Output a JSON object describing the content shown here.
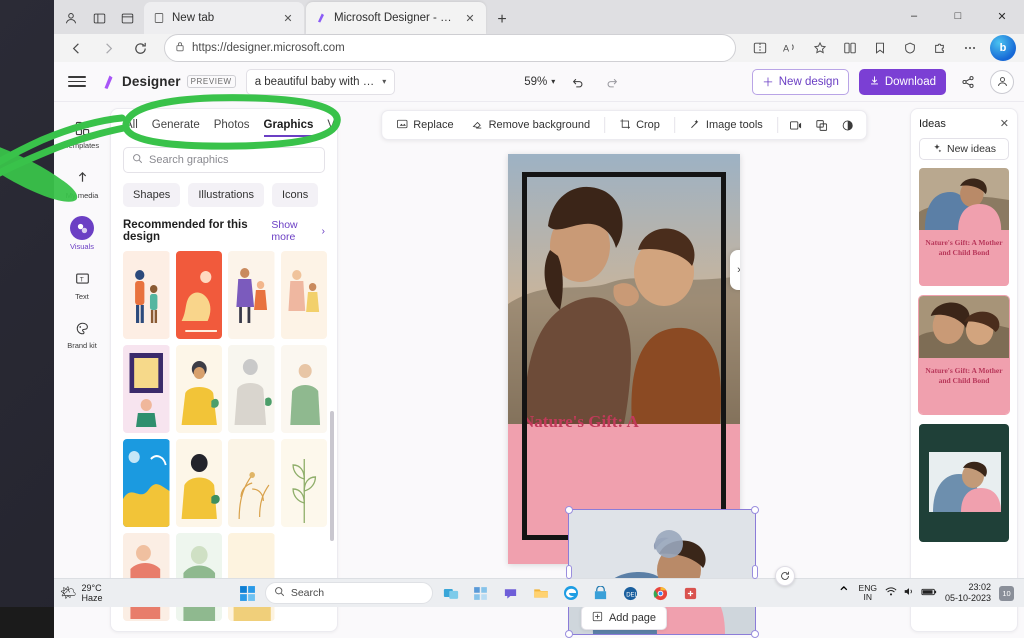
{
  "browser": {
    "tabs": [
      {
        "label": "New tab",
        "favicon": "page-icon",
        "active": false
      },
      {
        "label": "Microsoft Designer - Stunning d…",
        "favicon": "designer-icon",
        "active": true
      }
    ],
    "new_tab_label": "+",
    "url": "https://designer.microsoft.com",
    "url_lock_icon": "lock-icon",
    "window_controls": {
      "minimize": "–",
      "maximize": "□",
      "close": "✕"
    },
    "nav": {
      "back": "back-icon",
      "forward": "forward-icon",
      "refresh": "refresh-icon",
      "split_screen": "split-screen-icon",
      "read_aloud": "read-aloud-icon",
      "favorite": "star-icon",
      "collections": "collections-icon",
      "favorites_bar": "favorites-icon",
      "browser_essentials": "essentials-icon",
      "extensions": "puzzle-icon",
      "settings": "more-icon",
      "copilot": "copilot-icon"
    }
  },
  "app": {
    "menu_icon": "hamburger-icon",
    "brand_name": "Designer",
    "brand_badge": "PREVIEW",
    "document_name": "a beautiful baby with …",
    "zoom_value": "59%",
    "undo_icon": "undo-icon",
    "redo_icon": "redo-icon",
    "new_design_label": "New design",
    "download_label": "Download",
    "share_icon": "share-icon",
    "account_icon": "person-icon"
  },
  "rail": {
    "items": [
      {
        "label": "Templates",
        "icon": "templates-icon",
        "active": false
      },
      {
        "label": "My media",
        "icon": "upload-icon",
        "active": false
      },
      {
        "label": "Visuals",
        "icon": "visuals-icon",
        "active": true
      },
      {
        "label": "Text",
        "icon": "text-icon",
        "active": false
      },
      {
        "label": "Brand kit",
        "icon": "brandkit-icon",
        "active": false
      }
    ]
  },
  "panel": {
    "tabs": [
      {
        "label": "All",
        "active": false
      },
      {
        "label": "Generate",
        "active": false
      },
      {
        "label": "Photos",
        "active": false
      },
      {
        "label": "Graphics",
        "active": true
      },
      {
        "label": "Videos",
        "active": false
      }
    ],
    "search_placeholder": "Search graphics",
    "search_icon": "search-icon",
    "chips": [
      "Shapes",
      "Illustrations",
      "Icons"
    ],
    "section_title": "Recommended for this design",
    "show_more_label": "Show more",
    "show_more_icon": "chevron-right-icon",
    "thumb_count": 16
  },
  "canvas": {
    "toolbar": [
      {
        "label": "Replace",
        "icon": "replace-icon"
      },
      {
        "label": "Remove background",
        "icon": "eraser-icon"
      },
      {
        "label": "Crop",
        "icon": "crop-icon"
      },
      {
        "label": "Image tools",
        "icon": "magic-wand-icon"
      }
    ],
    "toolbar_icons": [
      "animate-icon",
      "layers-icon",
      "filter-icon"
    ],
    "page_title": "Nature's Gift: A",
    "add_page_label": "Add page",
    "add_page_icon": "plus-square-icon",
    "rotate_icon": "rotate-icon",
    "next_page_icon": "chevron-right-icon"
  },
  "ideas": {
    "title": "Ideas",
    "close_icon": "close-icon",
    "new_ideas_label": "New ideas",
    "new_ideas_icon": "sparkle-icon",
    "cards": [
      {
        "caption": "Nature's Gift: A Mother and Child Bond",
        "theme": "pink",
        "selected": false
      },
      {
        "caption": "Nature's Gift: A Mother and Child Bond",
        "theme": "pink",
        "selected": true
      },
      {
        "caption": "",
        "theme": "dark",
        "selected": false
      }
    ]
  },
  "taskbar": {
    "weather_temp": "29°C",
    "weather_desc": "Haze",
    "weather_icon": "haze-icon",
    "start_icon": "windows-icon",
    "search_placeholder": "Search",
    "search_icon": "search-icon",
    "apps": [
      "task-view-icon",
      "widgets-icon",
      "chat-icon",
      "explorer-icon",
      "edge-icon",
      "store-icon",
      "dell-icon",
      "chrome-icon",
      "other-icon"
    ],
    "tray_lang_line1": "ENG",
    "tray_lang_line2": "IN",
    "tray_icons": [
      "wifi-icon",
      "volume-icon",
      "battery-icon"
    ],
    "chevron_icon": "chevron-up-icon",
    "time": "23:02",
    "date": "05-10-2023",
    "notification_count": "10"
  },
  "annotation": {
    "color": "#39c24a",
    "shape": "ellipse-highlight-over-panel-tabs"
  },
  "colors": {
    "accent": "#6b3fc4",
    "download_button": "#7b3fd4",
    "page_pink": "#f0a0ae",
    "title_pink": "#c13a5a",
    "annotation_green": "#39c24a"
  }
}
